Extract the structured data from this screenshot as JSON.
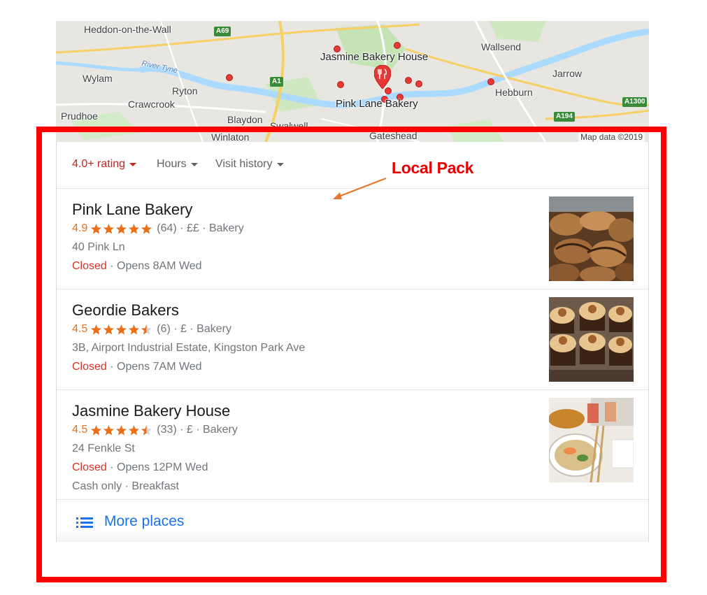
{
  "map": {
    "labels": {
      "heddon": "Heddon-on-the-Wall",
      "wylam": "Wylam",
      "river_tyne": "River Tyne",
      "ryton": "Ryton",
      "crawcrook": "Crawcrook",
      "prudhoe": "Prudhoe",
      "blaydon": "Blaydon",
      "swalwell": "Swalwell",
      "winlaton": "Winlaton",
      "gateshead": "Gateshead",
      "wallsend": "Wallsend",
      "jarrow": "Jarrow",
      "hebburn": "Hebburn",
      "jasmine": "Jasmine Bakery House",
      "pinklane": "Pink Lane Bakery"
    },
    "roads": {
      "a69": "A69",
      "a1": "A1",
      "a194": "A194",
      "a1300": "A1300"
    },
    "attribution": "Map data ©2019"
  },
  "annotation": {
    "label": "Local Pack",
    "color": "#ff0000"
  },
  "filters": [
    {
      "label": "4.0+ rating",
      "active": true
    },
    {
      "label": "Hours",
      "active": false
    },
    {
      "label": "Visit history",
      "active": false
    }
  ],
  "listings": [
    {
      "name": "Pink Lane Bakery",
      "rating": "4.9",
      "stars": 5,
      "reviews": "(64)",
      "price": "££",
      "category": "Bakery",
      "address": "40 Pink Ln",
      "status": "Closed",
      "hours": "Opens 8AM Wed",
      "extra": ""
    },
    {
      "name": "Geordie Bakers",
      "rating": "4.5",
      "stars": 4.5,
      "reviews": "(6)",
      "price": "£",
      "category": "Bakery",
      "address": "3B, Airport Industrial Estate, Kingston Park Ave",
      "status": "Closed",
      "hours": "Opens 7AM Wed",
      "extra": ""
    },
    {
      "name": "Jasmine Bakery House",
      "rating": "4.5",
      "stars": 4.5,
      "reviews": "(33)",
      "price": "£",
      "category": "Bakery",
      "address": "24 Fenkle St",
      "status": "Closed",
      "hours": "Opens 12PM Wed",
      "extra": "Cash only · Breakfast"
    }
  ],
  "more_places": {
    "label": "More places",
    "icon": "list-icon"
  },
  "colors": {
    "rating": "#e7711b",
    "closed": "#d93025",
    "link": "#1a73e8",
    "filter_active": "#c5221f"
  }
}
